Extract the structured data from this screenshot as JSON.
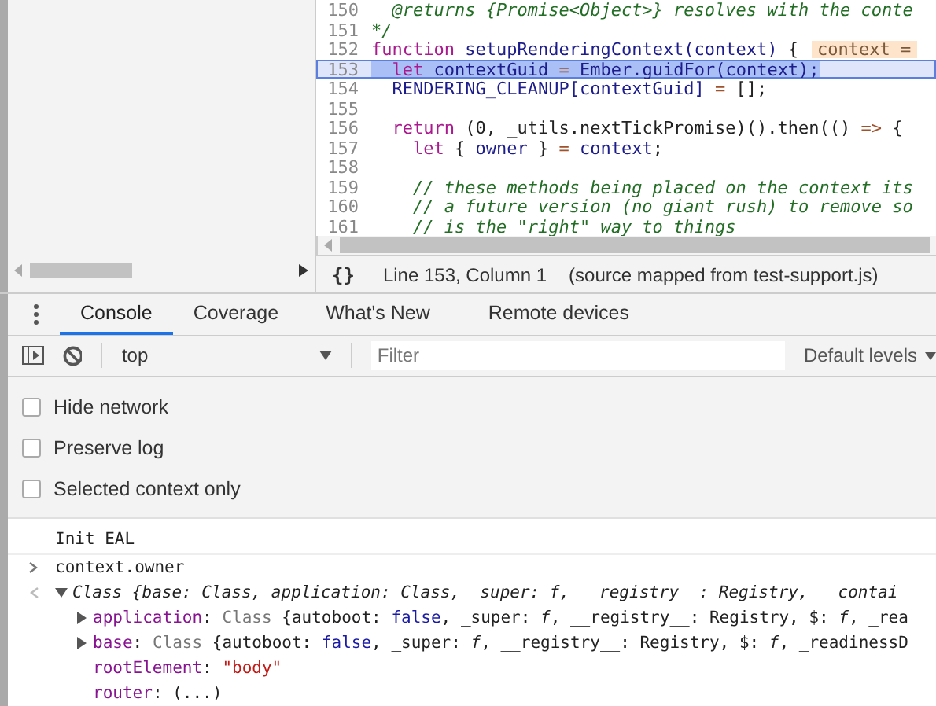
{
  "code": {
    "lines": [
      {
        "number": "150",
        "highlighted": false,
        "tokens": [
          {
            "kind": "comment",
            "text": "  @returns {Promise<Object>} resolves with the conte"
          }
        ]
      },
      {
        "number": "151",
        "highlighted": false,
        "tokens": [
          {
            "kind": "comment",
            "text": "*/"
          }
        ]
      },
      {
        "number": "152",
        "highlighted": false,
        "tokens": [
          {
            "kind": "keyword",
            "text": "function "
          },
          {
            "kind": "ident",
            "text": "setupRenderingContext(context) "
          },
          {
            "kind": "plain",
            "text": "{"
          }
        ],
        "inline_value": "context ="
      },
      {
        "number": "153",
        "highlighted": true,
        "tokens": [
          {
            "kind": "keyword",
            "text": "  let "
          },
          {
            "kind": "ident",
            "text": "contextGuid "
          },
          {
            "kind": "op",
            "text": "= "
          },
          {
            "kind": "ident",
            "text": "Ember.guidFor(context);"
          }
        ]
      },
      {
        "number": "154",
        "highlighted": false,
        "tokens": [
          {
            "kind": "ident",
            "text": "  RENDERING_CLEANUP[contextGuid] "
          },
          {
            "kind": "op",
            "text": "= "
          },
          {
            "kind": "plain",
            "text": "[];"
          }
        ]
      },
      {
        "number": "155",
        "highlighted": false
      },
      {
        "number": "156",
        "highlighted": false,
        "tokens": [
          {
            "kind": "keyword",
            "text": "  return "
          },
          {
            "kind": "plain",
            "text": "(0, _utils.nextTickPromise)().then(() "
          },
          {
            "kind": "op",
            "text": "=> "
          },
          {
            "kind": "plain",
            "text": "{"
          }
        ]
      },
      {
        "number": "157",
        "highlighted": false,
        "tokens": [
          {
            "kind": "keyword",
            "text": "    let "
          },
          {
            "kind": "plain",
            "text": "{ "
          },
          {
            "kind": "ident",
            "text": "owner "
          },
          {
            "kind": "plain",
            "text": "} "
          },
          {
            "kind": "op",
            "text": "= "
          },
          {
            "kind": "ident",
            "text": "context"
          },
          {
            "kind": "plain",
            "text": ";"
          }
        ]
      },
      {
        "number": "158",
        "highlighted": false
      },
      {
        "number": "159",
        "highlighted": false,
        "tokens": [
          {
            "kind": "comment",
            "text": "    // these methods being placed on the context its"
          }
        ]
      },
      {
        "number": "160",
        "highlighted": false,
        "tokens": [
          {
            "kind": "comment",
            "text": "    // a future version (no giant rush) to remove so"
          }
        ]
      },
      {
        "number": "161",
        "highlighted": false,
        "tokens": [
          {
            "kind": "comment",
            "text": "    // is the \"right\" way to things"
          }
        ]
      }
    ]
  },
  "status_bar": {
    "format_icon": "{}",
    "position": "Line 153, Column 1",
    "source": "(source mapped from test-support.js)"
  },
  "drawer_tabs": [
    {
      "label": "Console",
      "selected": true
    },
    {
      "label": "Coverage",
      "selected": false
    },
    {
      "label": "What's New",
      "selected": false
    },
    {
      "label": "Remote devices",
      "selected": false
    }
  ],
  "console_toolbar": {
    "context": "top",
    "filter": {
      "placeholder": "Filter"
    },
    "levels": "Default levels"
  },
  "settings": [
    {
      "label": "Hide network",
      "checked": false
    },
    {
      "label": "Preserve log",
      "checked": false
    },
    {
      "label": "Selected context only",
      "checked": false
    }
  ],
  "messages": [
    {
      "kind": "log",
      "tokens": [
        {
          "kind": "plain",
          "text": "Init EAL"
        }
      ]
    },
    {
      "kind": "input",
      "tokens": [
        {
          "kind": "plain",
          "text": "context.owner"
        }
      ]
    },
    {
      "kind": "result",
      "expanded": true,
      "tokens": [
        {
          "kind": "italic",
          "text": "Class {base: Class, application: Class, _super: f, __registry__: Registry, __contai"
        }
      ]
    },
    {
      "kind": "property",
      "expanded": false,
      "tokens": [
        {
          "kind": "name",
          "text": "application"
        },
        {
          "kind": "plain",
          "text": ": "
        },
        {
          "kind": "class",
          "text": "Class "
        },
        {
          "kind": "plain",
          "text": "{autoboot: "
        },
        {
          "kind": "value",
          "text": "false"
        },
        {
          "kind": "plain",
          "text": ", _super: "
        },
        {
          "kind": "italic",
          "text": "f"
        },
        {
          "kind": "plain",
          "text": ", __registry__: Registry, $: "
        },
        {
          "kind": "italic",
          "text": "f"
        },
        {
          "kind": "plain",
          "text": ", _rea"
        }
      ]
    },
    {
      "kind": "property",
      "expanded": false,
      "tokens": [
        {
          "kind": "name",
          "text": "base"
        },
        {
          "kind": "plain",
          "text": ": "
        },
        {
          "kind": "class",
          "text": "Class "
        },
        {
          "kind": "plain",
          "text": "{autoboot: "
        },
        {
          "kind": "value",
          "text": "false"
        },
        {
          "kind": "plain",
          "text": ", _super: "
        },
        {
          "kind": "italic",
          "text": "f"
        },
        {
          "kind": "plain",
          "text": ", __registry__: Registry, $: "
        },
        {
          "kind": "italic",
          "text": "f"
        },
        {
          "kind": "plain",
          "text": ", _readinessD"
        }
      ]
    },
    {
      "kind": "leaf",
      "tokens": [
        {
          "kind": "name",
          "text": "rootElement"
        },
        {
          "kind": "plain",
          "text": ": "
        },
        {
          "kind": "string",
          "text": "\"body\""
        }
      ]
    },
    {
      "kind": "leaf",
      "tokens": [
        {
          "kind": "name",
          "text": "router"
        },
        {
          "kind": "plain",
          "text": ": (...)"
        }
      ]
    }
  ]
}
